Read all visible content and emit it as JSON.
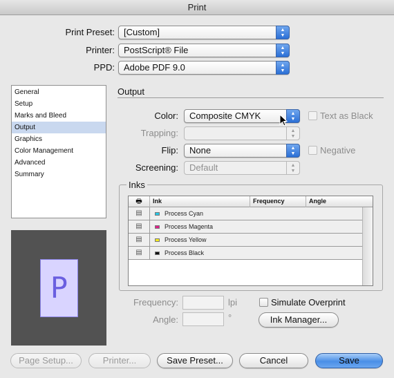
{
  "window": {
    "title": "Print"
  },
  "top_fields": {
    "print_preset": {
      "label": "Print Preset:",
      "value": "[Custom]"
    },
    "printer": {
      "label": "Printer:",
      "value": "PostScript® File"
    },
    "ppd": {
      "label": "PPD:",
      "value": "Adobe PDF 9.0"
    }
  },
  "sidebar": {
    "items": [
      {
        "label": "General"
      },
      {
        "label": "Setup"
      },
      {
        "label": "Marks and Bleed"
      },
      {
        "label": "Output",
        "selected": true
      },
      {
        "label": "Graphics"
      },
      {
        "label": "Color Management"
      },
      {
        "label": "Advanced"
      },
      {
        "label": "Summary"
      }
    ]
  },
  "preview": {
    "page_letter": "P"
  },
  "output": {
    "section_title": "Output",
    "color": {
      "label": "Color:",
      "value": "Composite CMYK"
    },
    "text_as_black": {
      "label": "Text as Black",
      "checked": false,
      "enabled": false
    },
    "trapping": {
      "label": "Trapping:",
      "value": "",
      "enabled": false
    },
    "flip": {
      "label": "Flip:",
      "value": "None"
    },
    "negative": {
      "label": "Negative",
      "checked": false,
      "enabled": false
    },
    "screening": {
      "label": "Screening:",
      "value": "Default",
      "enabled": false
    }
  },
  "inks": {
    "group_title": "Inks",
    "columns": {
      "print_icon": "printer-icon",
      "ink": "Ink",
      "frequency": "Frequency",
      "angle": "Angle"
    },
    "rows": [
      {
        "name": "Process Cyan",
        "color": "#28c8e6"
      },
      {
        "name": "Process Magenta",
        "color": "#e0208c"
      },
      {
        "name": "Process Yellow",
        "color": "#f4ea20"
      },
      {
        "name": "Process Black",
        "color": "#111111"
      }
    ],
    "frequency": {
      "label": "Frequency:",
      "value": "",
      "unit": "lpi"
    },
    "angle": {
      "label": "Angle:",
      "value": "",
      "unit": "°"
    },
    "simulate_overprint": {
      "label": "Simulate Overprint",
      "checked": false
    },
    "ink_manager_label": "Ink Manager..."
  },
  "buttons": {
    "page_setup": "Page Setup...",
    "printer": "Printer...",
    "save_preset": "Save Preset...",
    "cancel": "Cancel",
    "save": "Save"
  }
}
